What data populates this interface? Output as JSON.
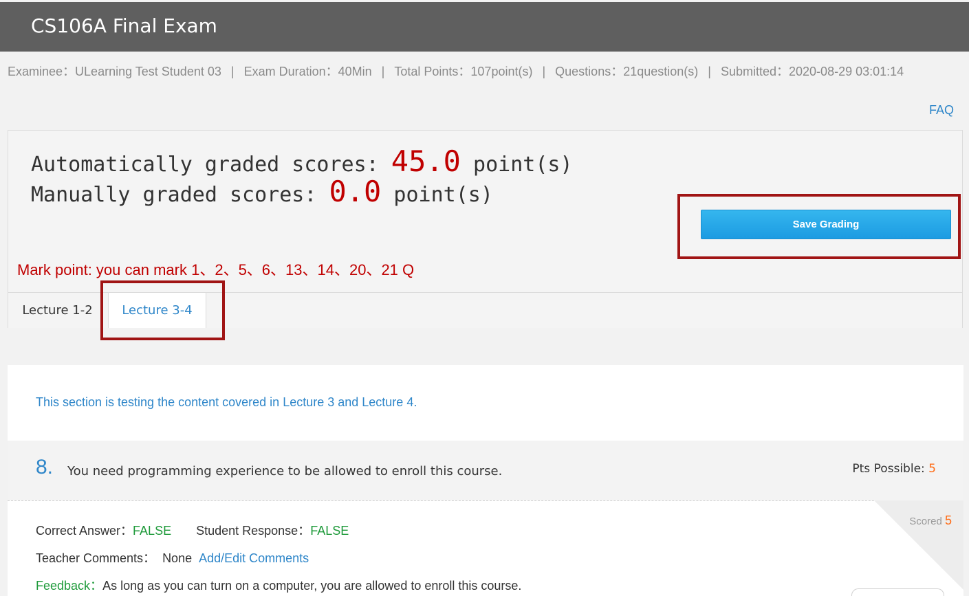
{
  "header": {
    "title": "CS106A Final Exam"
  },
  "meta": {
    "examinee_label": "Examinee：",
    "examinee": "ULearning Test Student 03",
    "duration_label": "Exam Duration：",
    "duration": "40Min",
    "total_label": "Total Points：",
    "total": "107point(s)",
    "questions_label": "Questions：",
    "questions": "21question(s)",
    "submitted_label": "Submitted：",
    "submitted": "2020-08-29 03:01:14",
    "separator": "|"
  },
  "faq_label": "FAQ",
  "scores": {
    "auto_label": "Automatically graded scores:",
    "auto_value": "45.0",
    "manual_label": "Manually graded scores:",
    "manual_value": "0.0",
    "unit": "point(s)"
  },
  "save_button": "Save Grading",
  "mark_point": "Mark point: you can mark 1、2、5、6、13、14、20、21 Q",
  "tabs": [
    {
      "label": "Lecture 1-2",
      "active": false
    },
    {
      "label": "Lecture 3-4",
      "active": true
    }
  ],
  "section_description": "This section is testing the content covered in Lecture 3 and Lecture 4.",
  "question": {
    "number": "8.",
    "text": "You need programming experience to be allowed to enroll this course.",
    "pts_label": "Pts Possible:",
    "pts_value": "5",
    "scored_label": "Scored",
    "scored_value": "5",
    "correct_label": "Correct Answer：",
    "correct_value": "FALSE",
    "response_label": "Student Response：",
    "response_value": "FALSE",
    "comments_label": "Teacher Comments：",
    "comments_value": "None",
    "comments_link": "Add/Edit Comments",
    "feedback_label": "Feedback：",
    "feedback_text": "As long as you can turn on a computer, you are allowed to enroll this course."
  },
  "colors": {
    "header_bg": "#5f5f5f",
    "score_red": "#c00000",
    "link_blue": "#2e86c9",
    "points_orange": "#ff6a13",
    "answer_green": "#1e9a3a",
    "highlight_box": "#a01414"
  }
}
